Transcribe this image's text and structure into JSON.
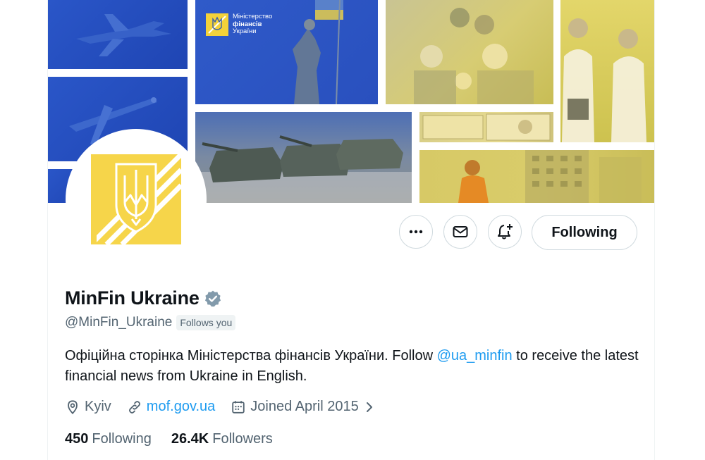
{
  "banner": {
    "logo_line1": "Міністерство",
    "logo_line2": "фінансів",
    "logo_line3": "України"
  },
  "actions": {
    "more_icon": "more-horizontal-icon",
    "message_icon": "envelope-icon",
    "notify_icon": "bell-plus-icon",
    "follow_label": "Following"
  },
  "profile": {
    "name": "MinFin Ukraine",
    "verified_icon": "verified-badge-icon",
    "handle": "@MinFin_Ukraine",
    "follows_you": "Follows you",
    "bio_part1": "Офіційна сторінка Міністерства фінансів України. Follow ",
    "bio_mention": "@ua_minfin",
    "bio_part2": " to receive the latest financial news from Ukraine in English.",
    "location": "Kyiv",
    "website": "mof.gov.ua",
    "joined": "Joined April 2015"
  },
  "stats": {
    "following_count": "450",
    "following_label": "Following",
    "followers_count": "26.4K",
    "followers_label": "Followers"
  },
  "colors": {
    "accent": "#1d9bf0",
    "brand_yellow": "#f6d54a",
    "brand_blue": "#2a56c8"
  }
}
